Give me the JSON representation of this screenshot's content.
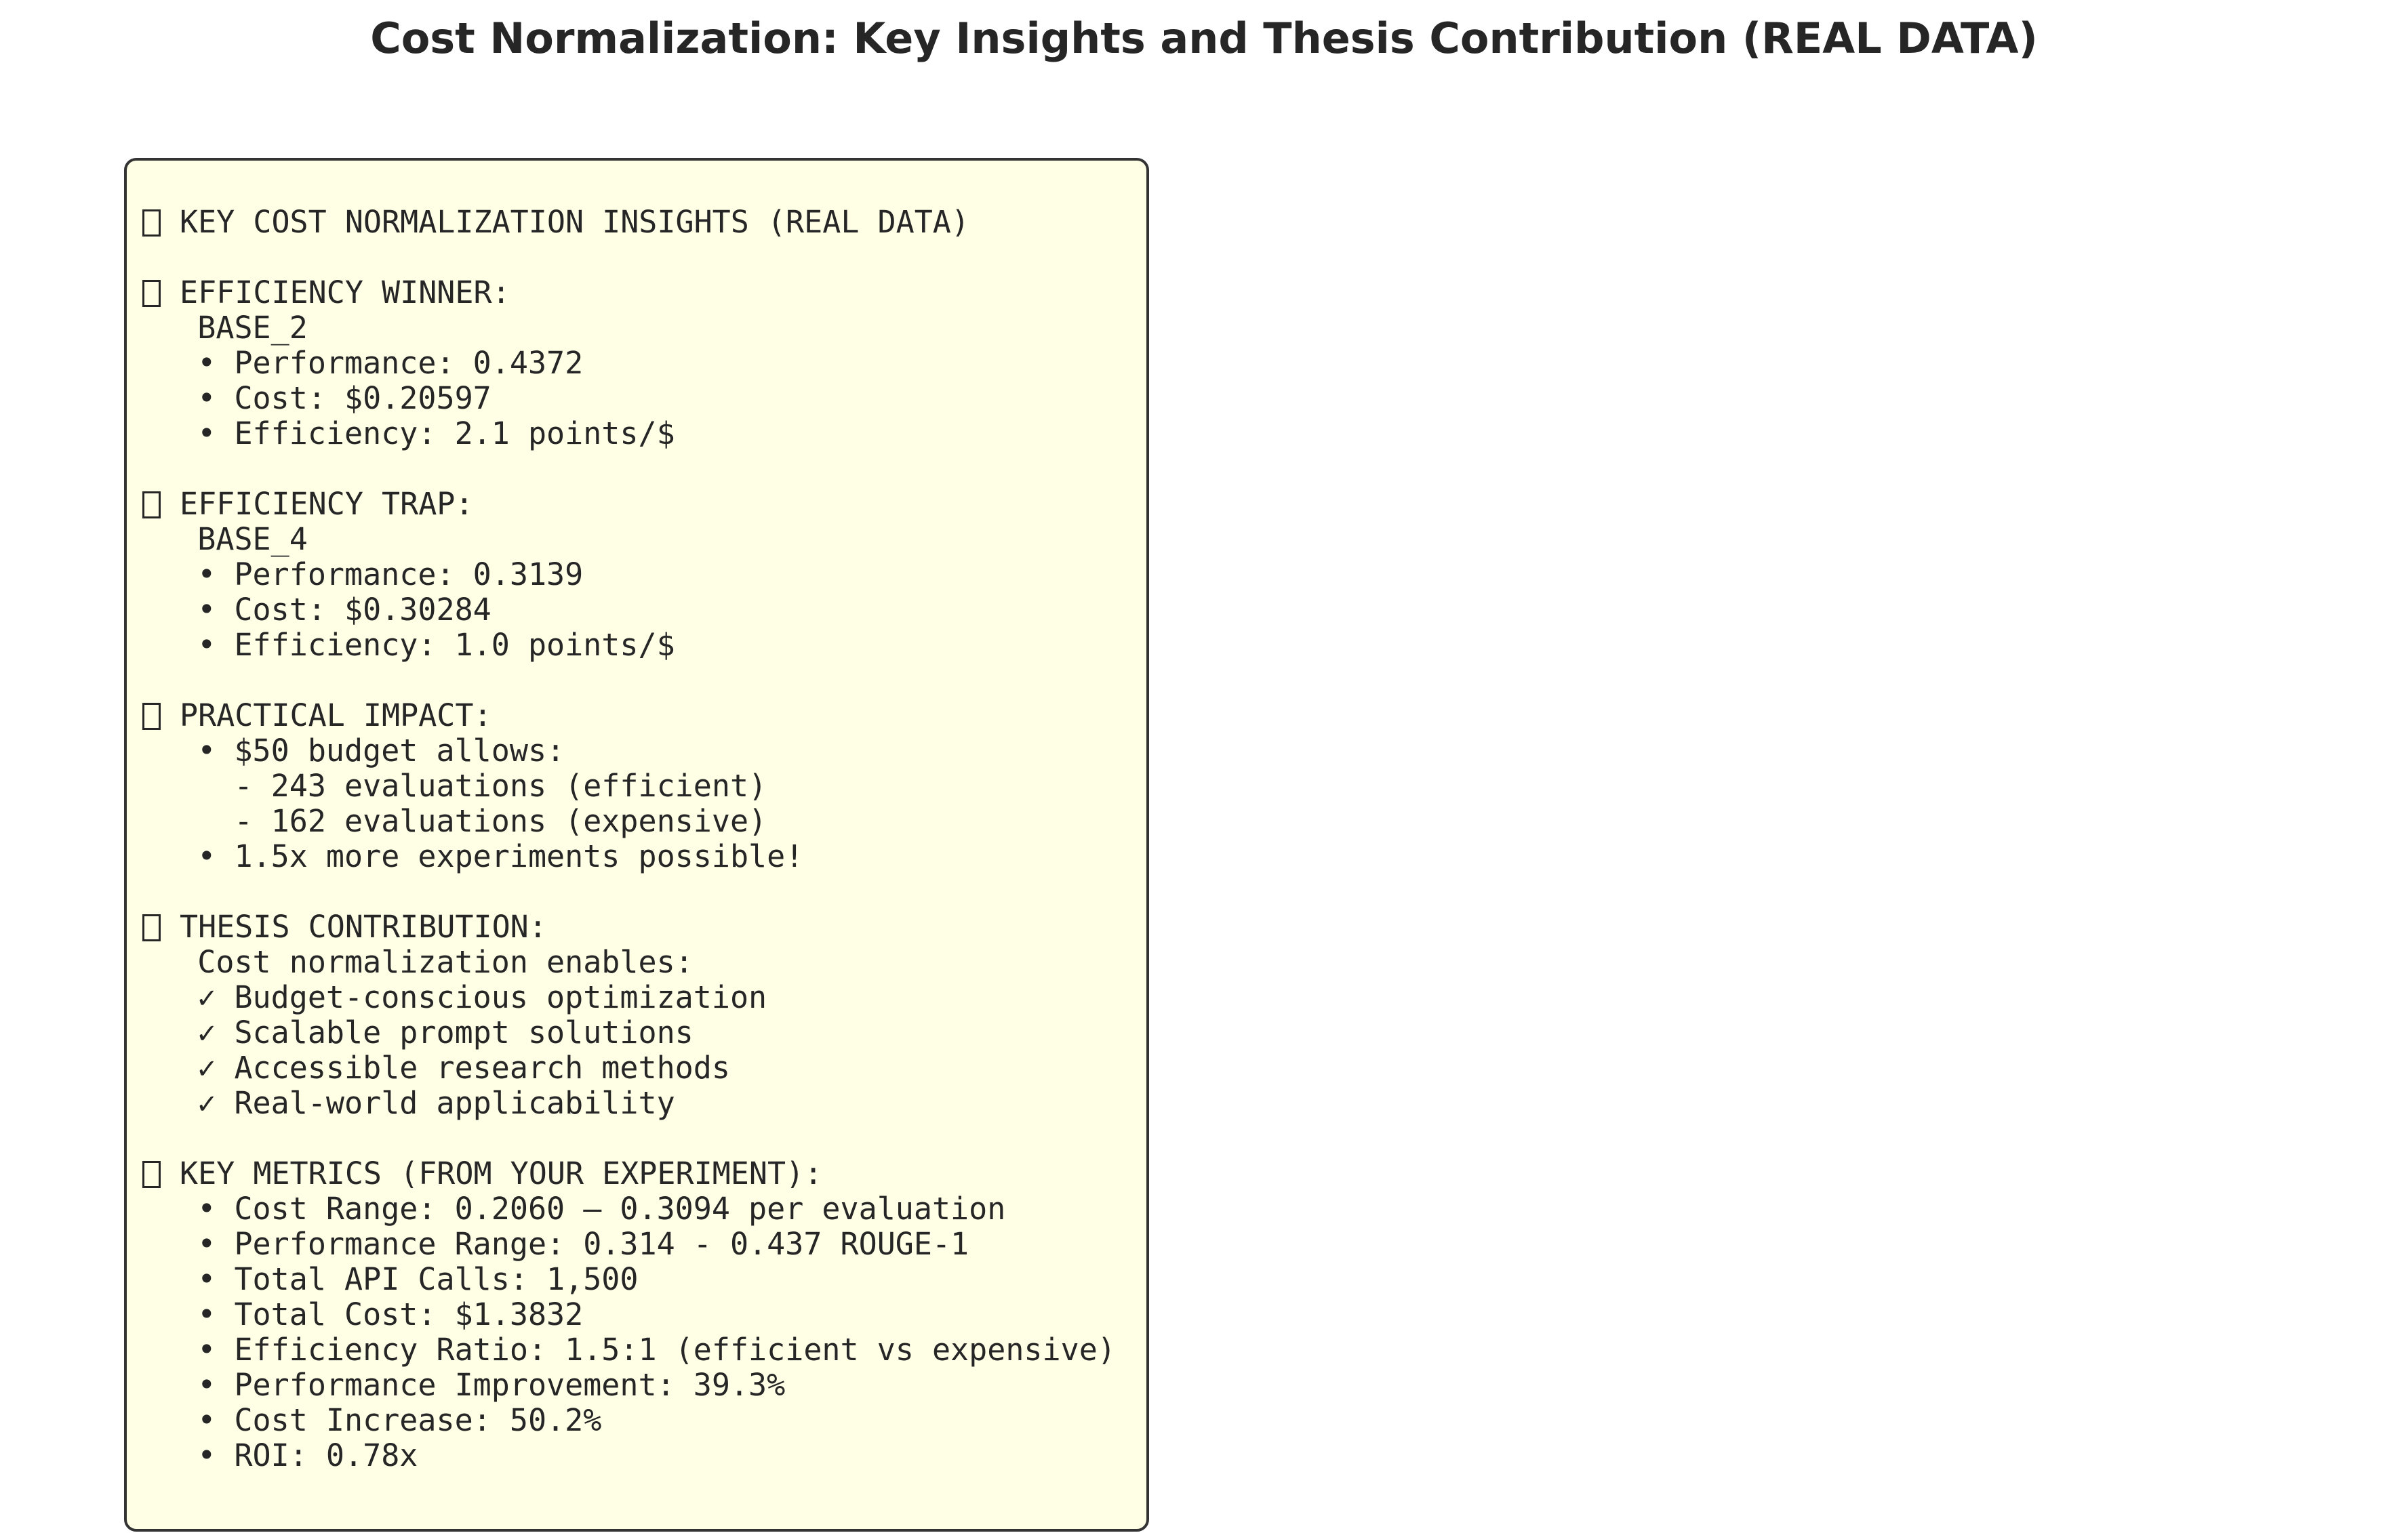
{
  "title": "Cost Normalization: Key Insights and Thesis Contribution (REAL DATA)",
  "box": {
    "background_color": "#ffffe6",
    "border_color": "#333333",
    "lines": [
      {
        "icon": "missing-glyph-icon",
        "text": "KEY COST NORMALIZATION INSIGHTS (REAL DATA)"
      },
      {
        "text": ""
      },
      {
        "icon": "missing-glyph-icon",
        "text": "EFFICIENCY WINNER:"
      },
      {
        "text": "   BASE_2"
      },
      {
        "text": "   • Performance: 0.4372"
      },
      {
        "text": "   • Cost: $0.20597"
      },
      {
        "text": "   • Efficiency: 2.1 points/$"
      },
      {
        "text": ""
      },
      {
        "icon": "missing-glyph-icon",
        "text": "EFFICIENCY TRAP:"
      },
      {
        "text": "   BASE_4"
      },
      {
        "text": "   • Performance: 0.3139"
      },
      {
        "text": "   • Cost: $0.30284"
      },
      {
        "text": "   • Efficiency: 1.0 points/$"
      },
      {
        "text": ""
      },
      {
        "icon": "missing-glyph-icon",
        "text": "PRACTICAL IMPACT:"
      },
      {
        "text": "   • $50 budget allows:"
      },
      {
        "text": "     - 243 evaluations (efficient)"
      },
      {
        "text": "     - 162 evaluations (expensive)"
      },
      {
        "text": "   • 1.5x more experiments possible!"
      },
      {
        "text": ""
      },
      {
        "icon": "missing-glyph-icon",
        "text": "THESIS CONTRIBUTION:"
      },
      {
        "text": "   Cost normalization enables:"
      },
      {
        "text": "   ✓ Budget-conscious optimization"
      },
      {
        "text": "   ✓ Scalable prompt solutions"
      },
      {
        "text": "   ✓ Accessible research methods"
      },
      {
        "text": "   ✓ Real-world applicability"
      },
      {
        "text": ""
      },
      {
        "icon": "missing-glyph-icon",
        "text": "KEY METRICS (FROM YOUR EXPERIMENT):"
      },
      {
        "text": "   • Cost Range: 0.2060 – 0.3094 per evaluation"
      },
      {
        "text": "   • Performance Range: 0.314 - 0.437 ROUGE-1"
      },
      {
        "text": "   • Total API Calls: 1,500"
      },
      {
        "text": "   • Total Cost: $1.3832"
      },
      {
        "text": "   • Efficiency Ratio: 1.5:1 (efficient vs expensive)"
      },
      {
        "text": "   • Performance Improvement: 39.3%"
      },
      {
        "text": "   • Cost Increase: 50.2%"
      },
      {
        "text": "   • ROI: 0.78x"
      }
    ]
  }
}
